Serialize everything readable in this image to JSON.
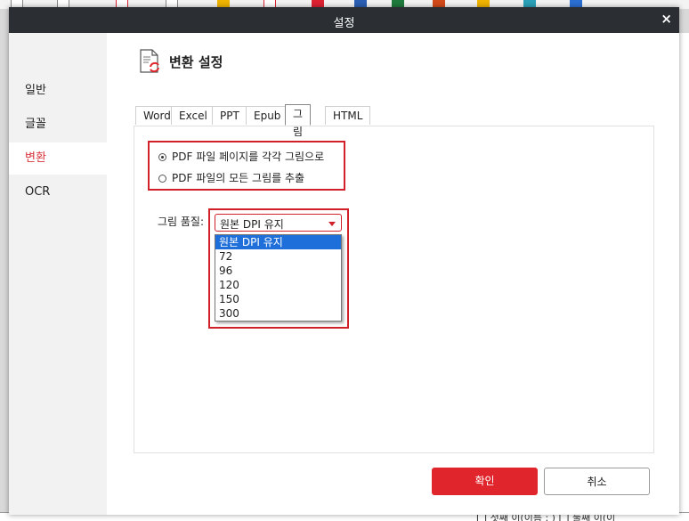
{
  "dialog": {
    "title": "설정",
    "close_glyph": "×"
  },
  "sidebar": {
    "items": [
      {
        "label": "일반"
      },
      {
        "label": "글꼴"
      },
      {
        "label": "변환",
        "active": true
      },
      {
        "label": "OCR"
      }
    ]
  },
  "heading": "변환 설정",
  "tabs": [
    {
      "label": "Word"
    },
    {
      "label": "Excel"
    },
    {
      "label": "PPT"
    },
    {
      "label": "Epub"
    },
    {
      "label": "그림",
      "active": true
    },
    {
      "label": "HTML"
    }
  ],
  "radios": [
    {
      "label": "PDF 파일 페이지를 각각 그림으로",
      "checked": true
    },
    {
      "label": "PDF 파일의 모든 그림를 추출",
      "checked": false
    }
  ],
  "quality": {
    "label": "그림 품질:",
    "selected": "원본 DPI 유지",
    "options": [
      "원본 DPI 유지",
      "72",
      "96",
      "120",
      "150",
      "300"
    ]
  },
  "buttons": {
    "ok": "확인",
    "cancel": "취소"
  },
  "background": {
    "bottom_text": "[ ] 첫째 이(이름 :          )     [ ] 둘째 이(이"
  },
  "colors": {
    "accent": "#e0262c",
    "selection": "#1e6fd9",
    "titlebar": "#2b2f33"
  }
}
